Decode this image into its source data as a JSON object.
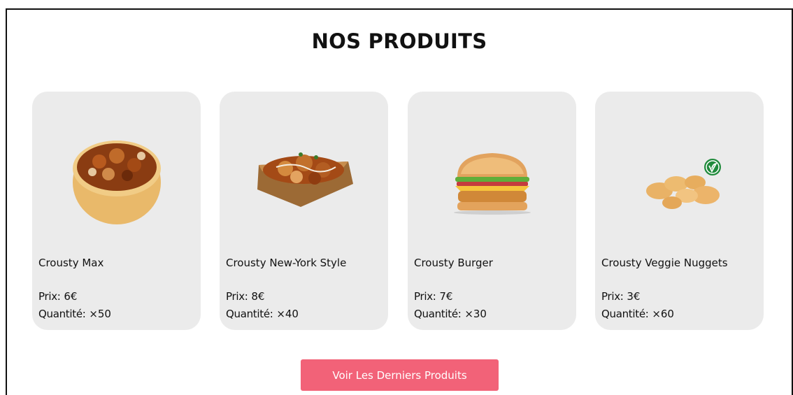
{
  "section": {
    "title": "NOS PRODUITS"
  },
  "labels": {
    "price": "Prix:",
    "quantity": "Quantité:"
  },
  "products": [
    {
      "name": "Crousty Max",
      "price": "6€",
      "quantity": "×50",
      "image": "bowl-food-icon"
    },
    {
      "name": "Crousty New-York Style",
      "price": "8€",
      "quantity": "×40",
      "image": "tray-food-icon"
    },
    {
      "name": "Crousty Burger",
      "price": "7€",
      "quantity": "×30",
      "image": "burger-icon"
    },
    {
      "name": "Crousty Veggie Nuggets",
      "price": "3€",
      "quantity": "×60",
      "image": "nuggets-icon",
      "badge": "vegan-leaf-icon"
    }
  ],
  "cta": {
    "label": "Voir Les Derniers Produits"
  },
  "colors": {
    "card_bg": "#ebebeb",
    "cta_bg": "#f26278",
    "badge_green": "#1f8a3b"
  }
}
